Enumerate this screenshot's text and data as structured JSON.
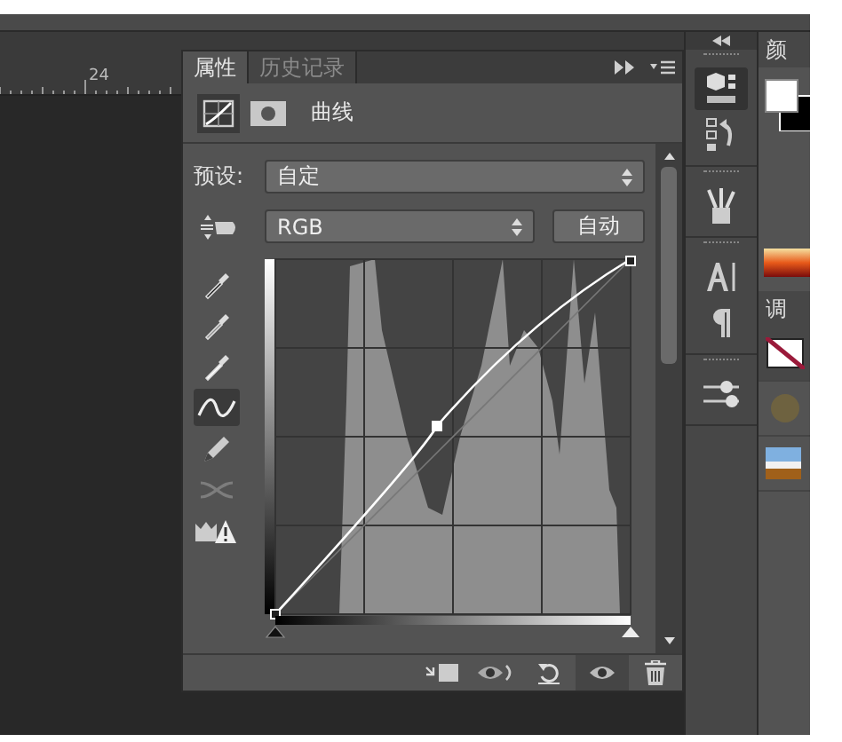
{
  "ruler": {
    "label": "24"
  },
  "properties_panel": {
    "tabs": [
      {
        "label": "属性",
        "selected": true
      },
      {
        "label": "历史记录",
        "selected": false
      }
    ],
    "adjustment_title": "曲线",
    "preset": {
      "label": "预设:",
      "value": "自定"
    },
    "channel": {
      "value": "RGB"
    },
    "auto_button": "自动",
    "tools": [
      {
        "kind": "eyedropper-black",
        "selected": false
      },
      {
        "kind": "eyedropper-gray",
        "selected": false
      },
      {
        "kind": "eyedropper-white",
        "selected": false
      },
      {
        "kind": "curve",
        "selected": true
      },
      {
        "kind": "pencil",
        "selected": false
      },
      {
        "kind": "smooth",
        "selected": false
      },
      {
        "kind": "clip-warning",
        "selected": false
      }
    ],
    "footer_buttons": [
      {
        "kind": "clip",
        "pressed": false
      },
      {
        "kind": "view-previous",
        "pressed": false
      },
      {
        "kind": "reset",
        "pressed": false
      },
      {
        "kind": "visibility",
        "pressed": true
      },
      {
        "kind": "delete",
        "pressed": false
      }
    ]
  },
  "dock": {
    "groups": [
      [
        {
          "kind": "cube",
          "selected": true
        },
        {
          "kind": "history",
          "selected": false
        }
      ],
      [
        {
          "kind": "brushes",
          "selected": false
        }
      ],
      [
        {
          "kind": "character",
          "selected": false
        },
        {
          "kind": "paragraph",
          "selected": false
        }
      ],
      [
        {
          "kind": "sliders",
          "selected": false
        }
      ]
    ]
  },
  "side_panel": {
    "color_tab": "颜",
    "adjust_tab": "调"
  }
}
